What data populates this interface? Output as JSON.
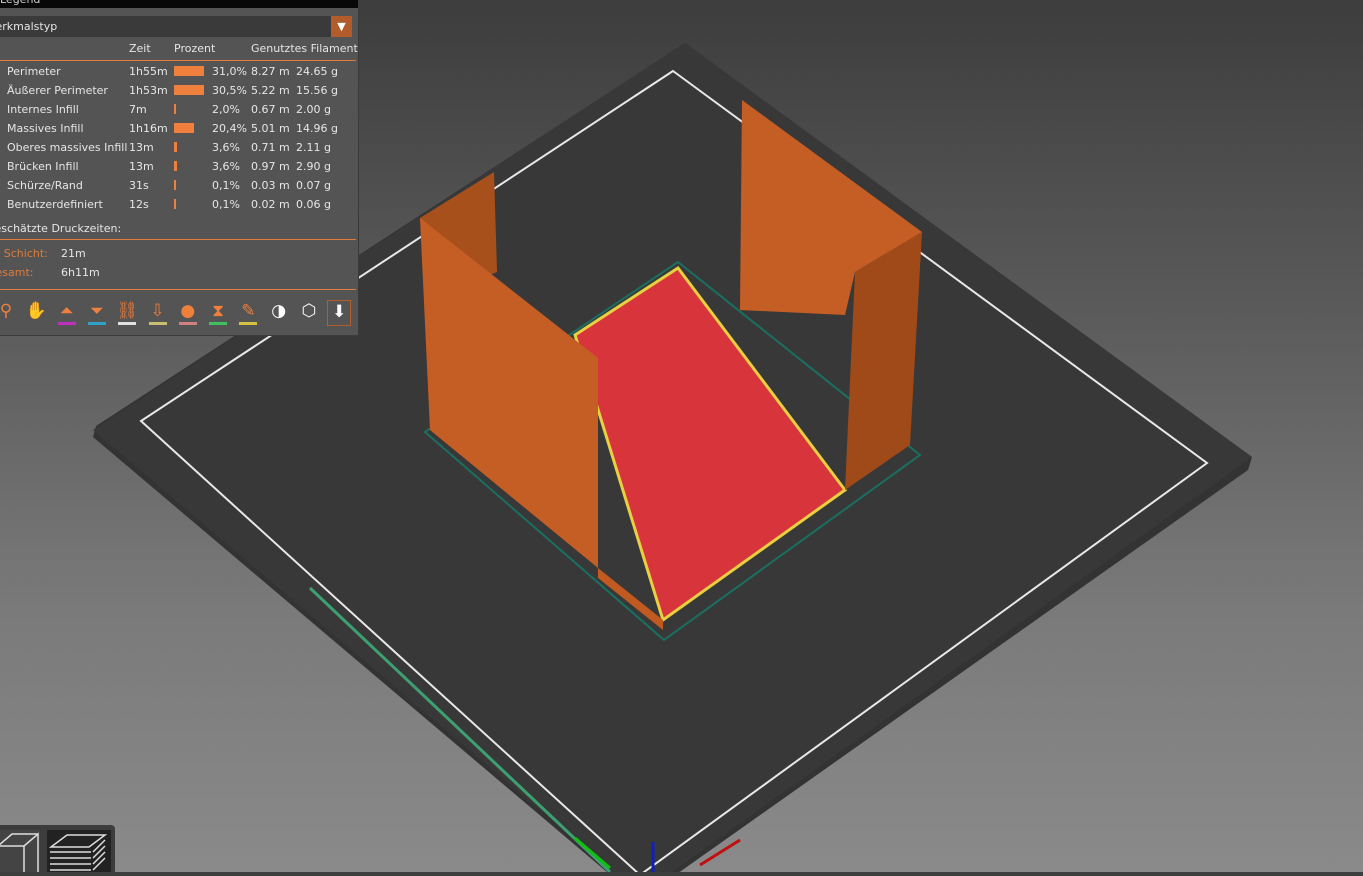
{
  "legend": {
    "title": "Legend",
    "view_type": "Merkmalstyp",
    "columns": {
      "time": "Zeit",
      "percent": "Prozent",
      "filament": "Genutztes Filament"
    },
    "rows": [
      {
        "name": "Perimeter",
        "time": "1h55m",
        "percent": "31,0%",
        "fraction": 0.31,
        "length": "8.27 m",
        "weight": "24.65 g"
      },
      {
        "name": "Äußerer Perimeter",
        "time": "1h53m",
        "percent": "30,5%",
        "fraction": 0.305,
        "length": "5.22 m",
        "weight": "15.56 g"
      },
      {
        "name": "Internes Infill",
        "time": "7m",
        "percent": "2,0%",
        "fraction": 0.02,
        "length": "0.67 m",
        "weight": "2.00 g"
      },
      {
        "name": "Massives Infill",
        "time": "1h16m",
        "percent": "20,4%",
        "fraction": 0.204,
        "length": "5.01 m",
        "weight": "14.96 g"
      },
      {
        "name": "Oberes massives Infill",
        "time": "13m",
        "percent": "3,6%",
        "fraction": 0.036,
        "length": "0.71 m",
        "weight": "2.11 g"
      },
      {
        "name": "Brücken Infill",
        "time": "13m",
        "percent": "3,6%",
        "fraction": 0.036,
        "length": "0.97 m",
        "weight": "2.90 g"
      },
      {
        "name": "Schürze/Rand",
        "time": "31s",
        "percent": "0,1%",
        "fraction": 0.001,
        "length": "0.03 m",
        "weight": "0.07 g"
      },
      {
        "name": "Benutzerdefiniert",
        "time": "12s",
        "percent": "0,1%",
        "fraction": 0.001,
        "length": "0.02 m",
        "weight": "0.06 g"
      }
    ],
    "estimated_label": "Geschätzte Druckzeiten:",
    "first_layer_label": "Erste Schicht:",
    "first_layer_value": "21m",
    "total_label": "Gesamt:",
    "total_value": "6h11m",
    "bar_color": "#ee7f3d"
  },
  "toolbar_icons": [
    {
      "icon": "travel-icon",
      "underline": ""
    },
    {
      "icon": "wipe-icon",
      "underline": ""
    },
    {
      "icon": "retractions-icon",
      "underline": "#c030c0"
    },
    {
      "icon": "deretractions-icon",
      "underline": "#30a0c8"
    },
    {
      "icon": "seams-icon",
      "underline": "#e0e0e0"
    },
    {
      "icon": "tool-changes-icon",
      "underline": "#c8c070"
    },
    {
      "icon": "color-changes-icon",
      "underline": "#d08080"
    },
    {
      "icon": "pause-prints-icon",
      "underline": "#40c060"
    },
    {
      "icon": "custom-gcode-icon",
      "underline": "#d8c040"
    },
    {
      "icon": "center-of-gravity-icon",
      "underline": ""
    },
    {
      "icon": "shells-icon",
      "underline": ""
    },
    {
      "icon": "tool-marker-icon",
      "underline": ""
    }
  ]
}
